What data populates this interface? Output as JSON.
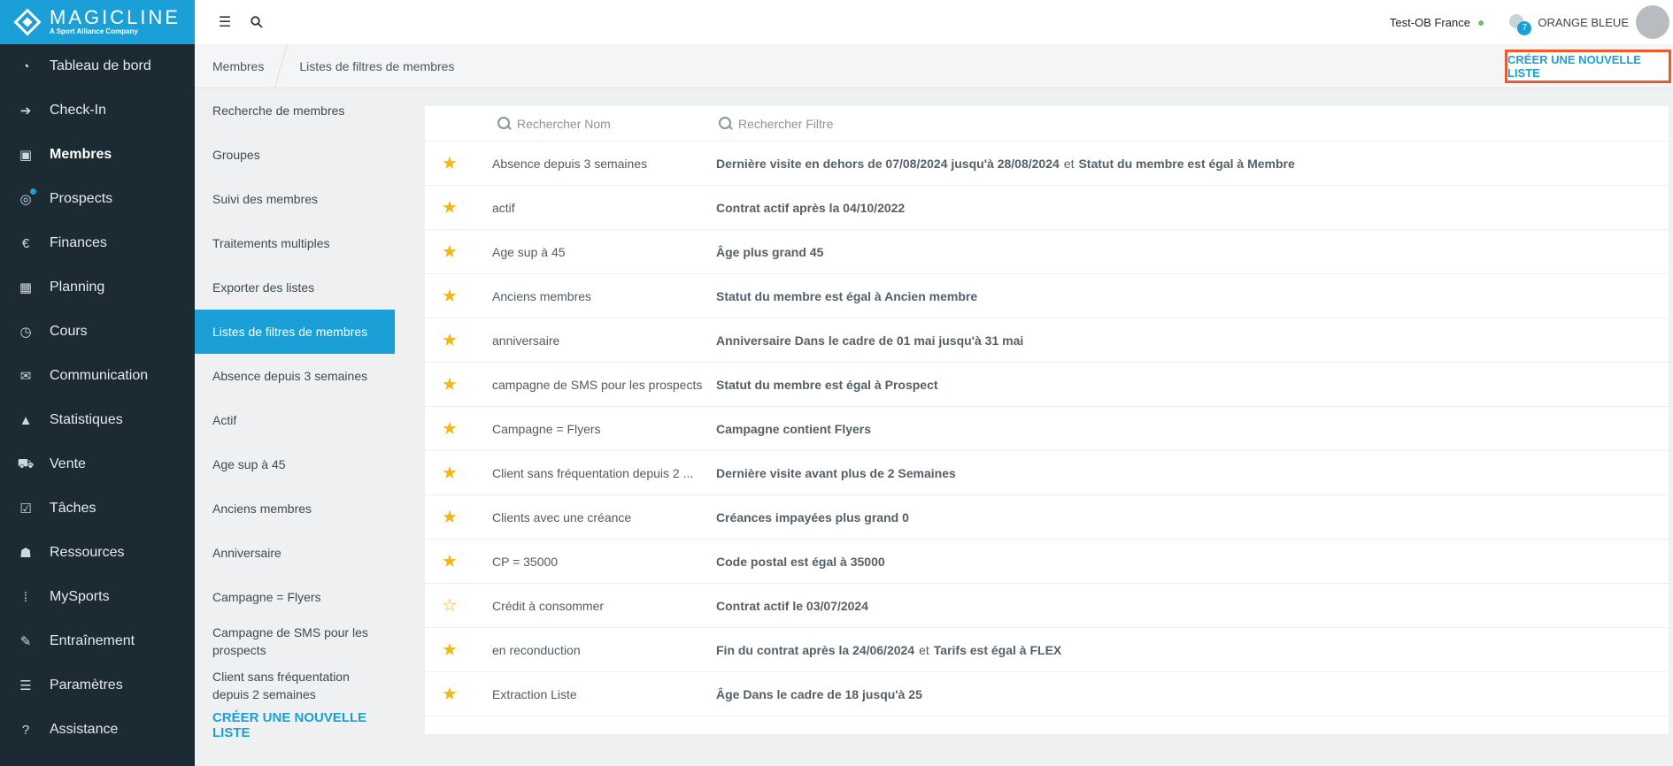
{
  "brand": {
    "name": "MAGICLINE",
    "tagline": "A Sport Alliance Company"
  },
  "sidebar": {
    "items": [
      {
        "label": "Tableau de bord",
        "icon": "dashboard-icon",
        "glyph": "◔"
      },
      {
        "label": "Check-In",
        "icon": "checkin-icon",
        "glyph": "➔"
      },
      {
        "label": "Membres",
        "icon": "members-icon",
        "glyph": "▣",
        "active": true
      },
      {
        "label": "Prospects",
        "icon": "prospects-icon",
        "glyph": "◎",
        "dot": true
      },
      {
        "label": "Finances",
        "icon": "finances-icon",
        "glyph": "€"
      },
      {
        "label": "Planning",
        "icon": "calendar-icon",
        "glyph": "▦"
      },
      {
        "label": "Cours",
        "icon": "timer-icon",
        "glyph": "◷"
      },
      {
        "label": "Communication",
        "icon": "chat-icon",
        "glyph": "✉"
      },
      {
        "label": "Statistiques",
        "icon": "chart-icon",
        "glyph": "▲"
      },
      {
        "label": "Vente",
        "icon": "cart-icon",
        "glyph": "⛟"
      },
      {
        "label": "Tâches",
        "icon": "checkbox-icon",
        "glyph": "☑"
      },
      {
        "label": "Ressources",
        "icon": "people-icon",
        "glyph": "☗"
      },
      {
        "label": "MySports",
        "icon": "grid-dots-icon",
        "glyph": "⁞"
      },
      {
        "label": "Entraînement",
        "icon": "dumbbell-icon",
        "glyph": "✎"
      },
      {
        "label": "Paramètres",
        "icon": "sliders-icon",
        "glyph": "☰"
      },
      {
        "label": "Assistance",
        "icon": "help-icon",
        "glyph": "?"
      }
    ]
  },
  "topbar": {
    "studio": "Test-OB France",
    "notifications": "7",
    "organization": "ORANGE BLEUE"
  },
  "breadcrumb": [
    "Membres",
    "Listes de filtres de membres"
  ],
  "create_button": "CRÉER UNE NOUVELLE LISTE",
  "subnav": {
    "items": [
      {
        "label": "Recherche de membres"
      },
      {
        "label": "Groupes"
      },
      {
        "label": "Suivi des membres"
      },
      {
        "label": "Traitements multiples"
      },
      {
        "label": "Exporter des listes"
      },
      {
        "label": "Listes de filtres de membres",
        "active": true
      },
      {
        "label": "Absence depuis 3 semaines"
      },
      {
        "label": "Actif"
      },
      {
        "label": "Age sup à 45"
      },
      {
        "label": "Anciens membres"
      },
      {
        "label": "Anniversaire"
      },
      {
        "label": "Campagne = Flyers"
      },
      {
        "label": "Campagne de SMS pour les prospects"
      },
      {
        "label": "Client sans fréquentation depuis 2 semaines"
      }
    ],
    "create_label": "CRÉER UNE NOUVELLE LISTE"
  },
  "table": {
    "search_name_placeholder": "Rechercher Nom",
    "search_filter_placeholder": "Rechercher Filtre",
    "rows": [
      {
        "favorite": true,
        "name": "Absence depuis 3 semaines",
        "filter": [
          "Dernière visite en dehors de 07/08/2024 jusqu'à 28/08/2024",
          "Statut du membre est égal à Membre"
        ]
      },
      {
        "favorite": true,
        "name": "actif",
        "filter": [
          "Contrat actif après la 04/10/2022"
        ]
      },
      {
        "favorite": true,
        "name": "Age sup à 45",
        "filter": [
          "Âge plus grand 45"
        ]
      },
      {
        "favorite": true,
        "name": "Anciens membres",
        "filter": [
          "Statut du membre est égal à Ancien membre"
        ]
      },
      {
        "favorite": true,
        "name": "anniversaire",
        "filter": [
          "Anniversaire Dans le cadre de 01 mai jusqu'à 31 mai"
        ]
      },
      {
        "favorite": true,
        "name": "campagne de SMS pour les prospects",
        "filter": [
          "Statut du membre est égal à Prospect"
        ]
      },
      {
        "favorite": true,
        "name": "Campagne = Flyers",
        "filter": [
          "Campagne contient Flyers"
        ]
      },
      {
        "favorite": true,
        "name": "Client sans fréquentation depuis 2 ...",
        "filter": [
          "Dernière visite avant plus de 2 Semaines"
        ]
      },
      {
        "favorite": true,
        "name": "Clients avec une créance",
        "filter": [
          "Créances impayées plus grand 0"
        ]
      },
      {
        "favorite": true,
        "name": "CP = 35000",
        "filter": [
          "Code postal est égal à 35000"
        ]
      },
      {
        "favorite": false,
        "name": "Crédit à consommer",
        "filter": [
          "Contrat actif le 03/07/2024"
        ]
      },
      {
        "favorite": true,
        "name": "en reconduction",
        "filter": [
          "Fin du contrat après la 24/06/2024",
          "Tarifs est égal à FLEX"
        ]
      },
      {
        "favorite": true,
        "name": "Extraction Liste",
        "filter": [
          "Âge Dans le cadre de 18 jusqu'à 25"
        ]
      }
    ],
    "conjunction": "et"
  },
  "colors": {
    "accent": "#1a9fd6",
    "sidebar": "#1c2b33",
    "highlight_border": "#ee5a2e",
    "star": "#f2b61f"
  }
}
